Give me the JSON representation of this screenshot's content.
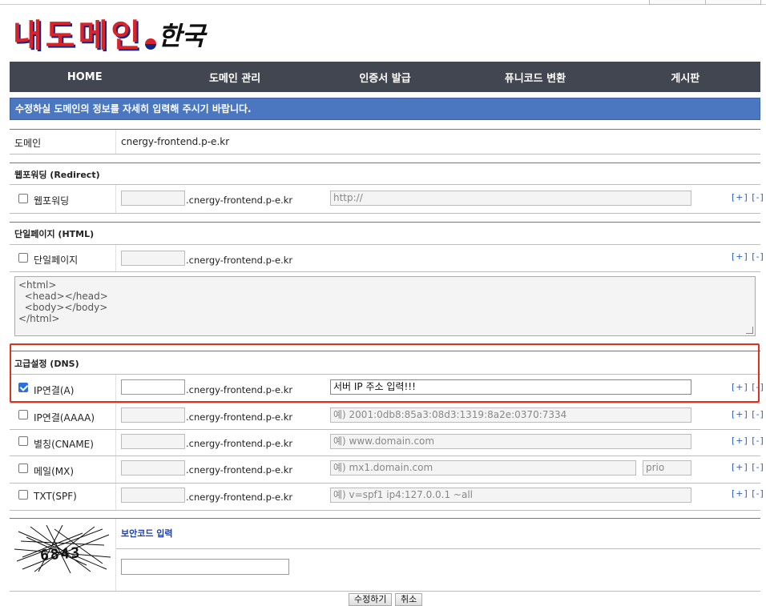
{
  "logo": {
    "name": "내도메인",
    "tld": "한국"
  },
  "nav": [
    "HOME",
    "도메인 관리",
    "인증서 발급",
    "퓨니코드 변환",
    "게시판"
  ],
  "notice": "수정하실 도메인의 정보를 자세히 입력해 주시기 바랍니다.",
  "domain": {
    "label": "도메인",
    "value": "cnergy-frontend.p-e.kr"
  },
  "suffix": ".cnergy-frontend.p-e.kr",
  "add_remove": "[+] [-]",
  "redirect": {
    "section_title": "웹포워딩 (Redirect)",
    "label": "웹포워딩",
    "checked": false,
    "url_value": "http://"
  },
  "html_page": {
    "section_title": "단일페이지 (HTML)",
    "label": "단일페이지",
    "checked": false,
    "content": "<html>\n  <head></head>\n  <body></body>\n</html>"
  },
  "dns": {
    "section_title": "고급설정 (DNS)",
    "records": [
      {
        "label": "IP연결(A)",
        "checked": true,
        "value": "서버 IP 주소 입력!!!",
        "placeholder": ""
      },
      {
        "label": "IP연결(AAAA)",
        "checked": false,
        "value": "",
        "placeholder": "예) 2001:0db8:85a3:08d3:1319:8a2e:0370:7334"
      },
      {
        "label": "별칭(CNAME)",
        "checked": false,
        "value": "",
        "placeholder": "예) www.domain.com"
      },
      {
        "label": "메일(MX)",
        "checked": false,
        "value": "",
        "placeholder": "예) mx1.domain.com",
        "prio_placeholder": "prio"
      },
      {
        "label": "TXT(SPF)",
        "checked": false,
        "value": "",
        "placeholder": "예) v=spf1 ip4:127.0.0.1 ~all"
      }
    ]
  },
  "security": {
    "label": "보안코드 입력",
    "captcha_text": "6843"
  },
  "buttons": {
    "submit": "수정하기",
    "cancel": "취소"
  },
  "colors": {
    "nav_bg": "#424651",
    "notice_bg": "#4a77c0",
    "highlight": "#e0301e",
    "link": "#2b5fbf"
  }
}
